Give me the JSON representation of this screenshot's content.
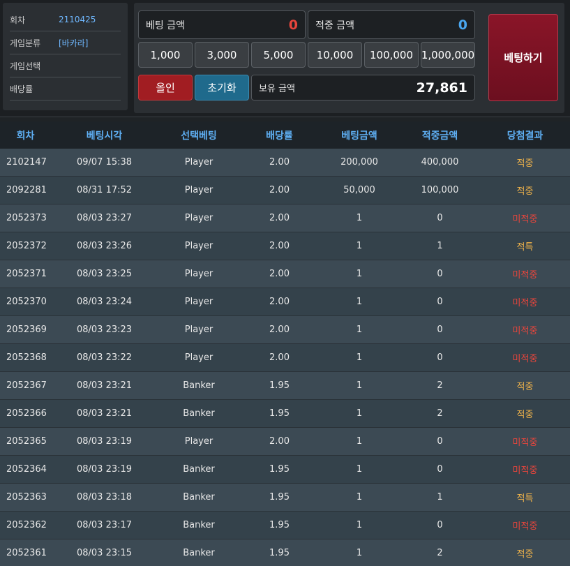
{
  "info": {
    "round_label": "회차",
    "round_value": "2110425",
    "category_label": "게임분류",
    "category_value": "[바카라]",
    "select_label": "게임선택",
    "select_value": "",
    "odds_label": "배당률",
    "odds_value": ""
  },
  "bet": {
    "bet_amount_label": "베팅 금액",
    "bet_amount_value": "0",
    "win_amount_label": "적중 금액",
    "win_amount_value": "0",
    "chips": [
      "1,000",
      "3,000",
      "5,000",
      "10,000",
      "100,000",
      "1,000,000"
    ],
    "allin_label": "올인",
    "reset_label": "초기화",
    "balance_label": "보유 금액",
    "balance_value": "27,861",
    "bet_button_label": "베팅하기"
  },
  "table": {
    "headers": [
      "회차",
      "베팅시각",
      "선택베팅",
      "배당률",
      "베팅금액",
      "적중금액",
      "당첨결과"
    ],
    "rows": [
      [
        "2102147",
        "09/07 15:38",
        "Player",
        "2.00",
        "200,000",
        "400,000",
        "적중"
      ],
      [
        "2092281",
        "08/31 17:52",
        "Player",
        "2.00",
        "50,000",
        "100,000",
        "적중"
      ],
      [
        "2052373",
        "08/03 23:27",
        "Player",
        "2.00",
        "1",
        "0",
        "미적중"
      ],
      [
        "2052372",
        "08/03 23:26",
        "Player",
        "2.00",
        "1",
        "1",
        "적특"
      ],
      [
        "2052371",
        "08/03 23:25",
        "Player",
        "2.00",
        "1",
        "0",
        "미적중"
      ],
      [
        "2052370",
        "08/03 23:24",
        "Player",
        "2.00",
        "1",
        "0",
        "미적중"
      ],
      [
        "2052369",
        "08/03 23:23",
        "Player",
        "2.00",
        "1",
        "0",
        "미적중"
      ],
      [
        "2052368",
        "08/03 23:22",
        "Player",
        "2.00",
        "1",
        "0",
        "미적중"
      ],
      [
        "2052367",
        "08/03 23:21",
        "Banker",
        "1.95",
        "1",
        "2",
        "적중"
      ],
      [
        "2052366",
        "08/03 23:21",
        "Banker",
        "1.95",
        "1",
        "2",
        "적중"
      ],
      [
        "2052365",
        "08/03 23:19",
        "Player",
        "2.00",
        "1",
        "0",
        "미적중"
      ],
      [
        "2052364",
        "08/03 23:19",
        "Banker",
        "1.95",
        "1",
        "0",
        "미적중"
      ],
      [
        "2052363",
        "08/03 23:18",
        "Banker",
        "1.95",
        "1",
        "1",
        "적특"
      ],
      [
        "2052362",
        "08/03 23:17",
        "Banker",
        "1.95",
        "1",
        "0",
        "미적중"
      ],
      [
        "2052361",
        "08/03 23:15",
        "Banker",
        "1.95",
        "1",
        "2",
        "적중"
      ]
    ]
  },
  "colors": {
    "win": "#f0b34a",
    "lose": "#e8453c",
    "header": "#5fb0f5",
    "bet_amount": "#e8453c",
    "win_amount": "#4aa7f0"
  }
}
